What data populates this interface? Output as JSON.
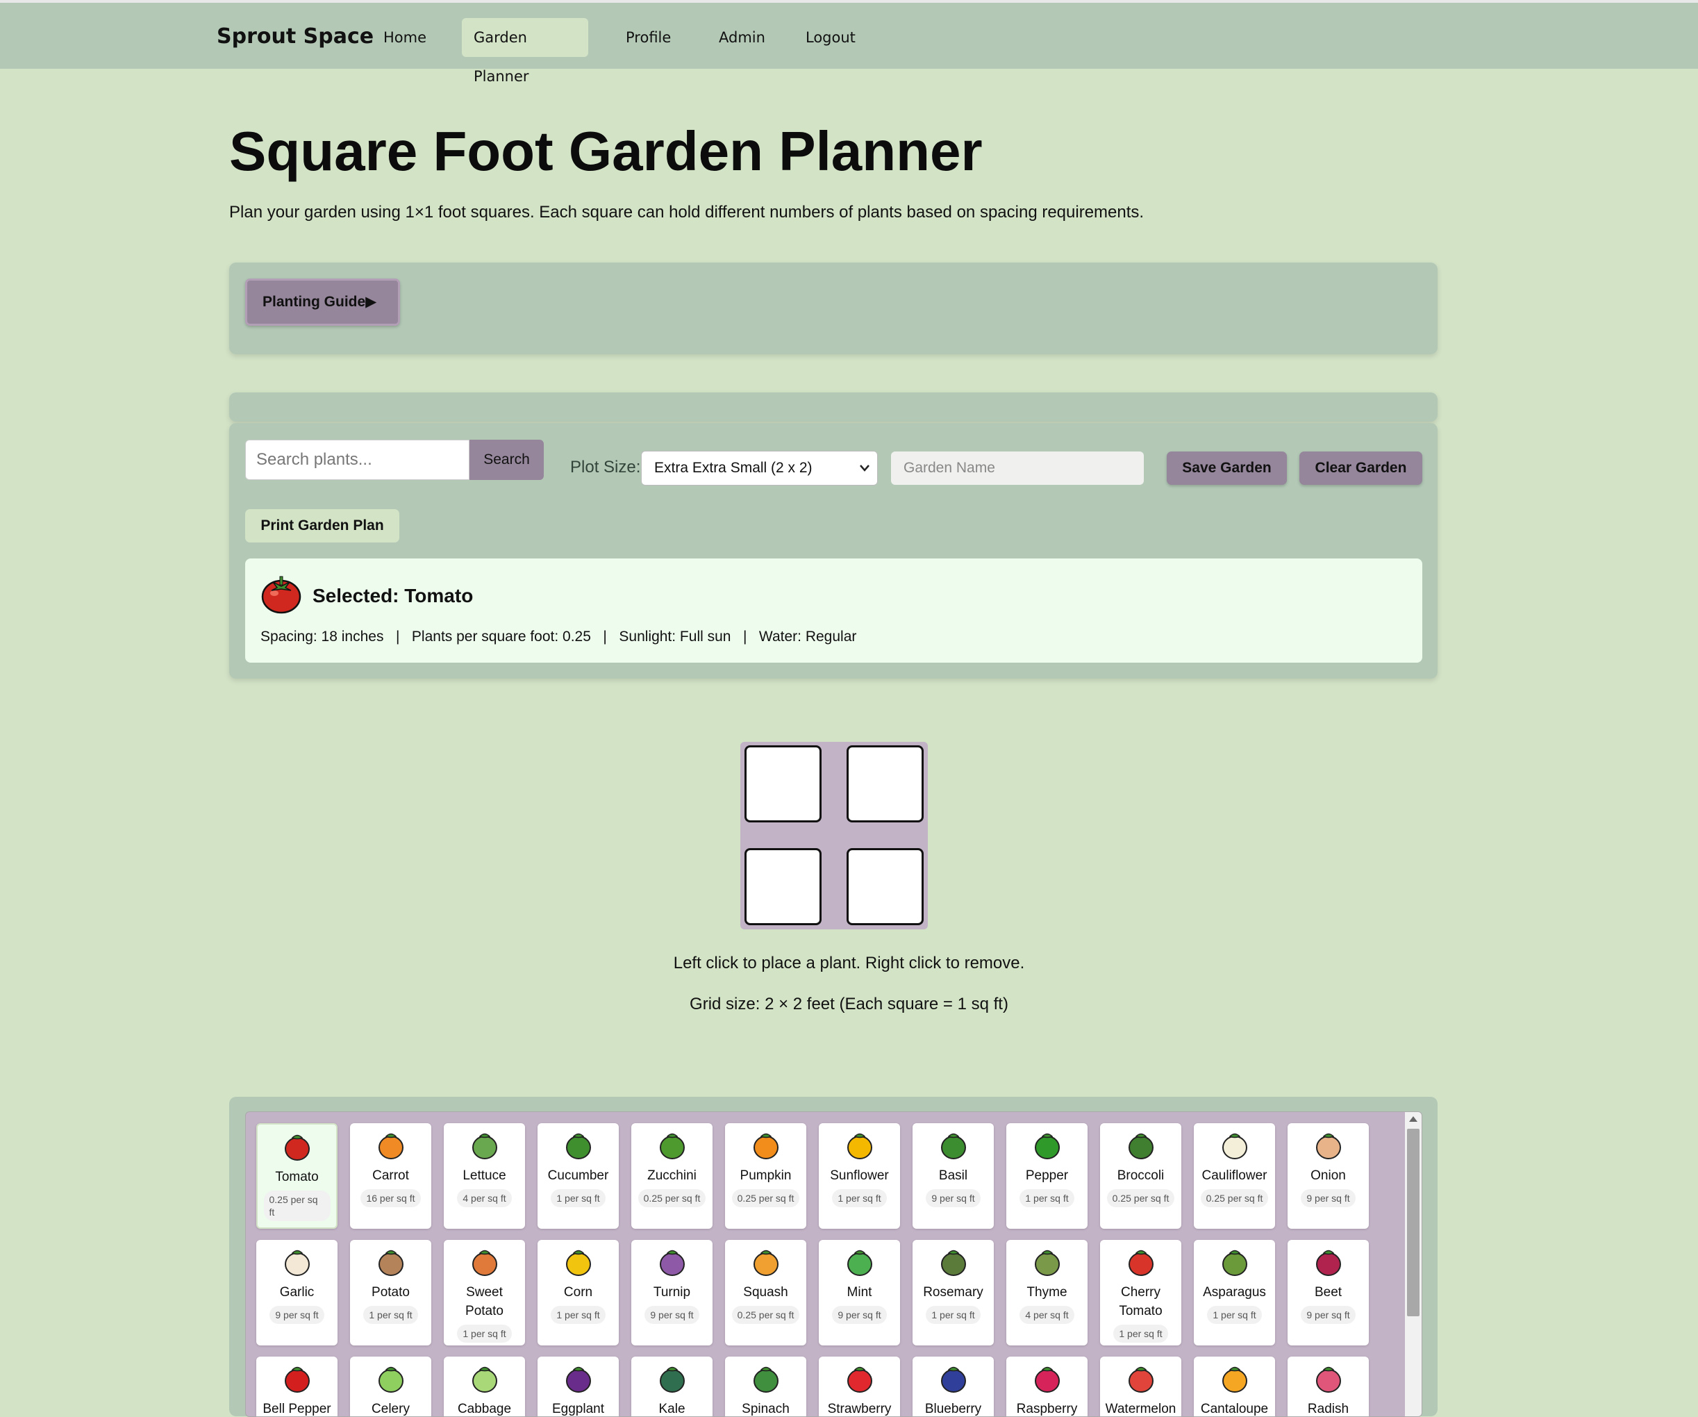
{
  "nav": {
    "brand": "Sprout Space",
    "items": [
      {
        "label": "Home",
        "active": false
      },
      {
        "label": "Garden Planner",
        "active": true
      },
      {
        "label": "Profile",
        "active": false
      },
      {
        "label": "Admin",
        "active": false
      },
      {
        "label": "Logout",
        "active": false
      }
    ]
  },
  "page": {
    "title": "Square Foot Garden Planner",
    "description": "Plan your garden using 1×1 foot squares. Each square can hold different numbers of plants based on spacing requirements."
  },
  "guide": {
    "label": "Planting Guide",
    "arrow": "▶"
  },
  "controls": {
    "search_placeholder": "Search plants...",
    "search_button": "Search",
    "plot_label": "Plot Size:",
    "plot_value": "Extra Extra Small (2 x 2)",
    "garden_name_placeholder": "Garden Name",
    "save_button": "Save Garden",
    "clear_button": "Clear Garden",
    "print_button": "Print Garden Plan"
  },
  "selected": {
    "title": "Selected: Tomato",
    "icon": "tomato-icon",
    "info": "Spacing: 18 inches   |   Plants per square foot: 0.25   |   Sunlight: Full sun   |   Water: Regular"
  },
  "grid": {
    "rows": 2,
    "cols": 2,
    "hint": "Left click to place a plant. Right click to remove.",
    "size_text": "Grid size: 2 × 2 feet (Each square = 1 sq ft)"
  },
  "plants": [
    {
      "name": "Tomato",
      "rate": "0.25 per sq ft",
      "color": "#d0281e",
      "selected": true
    },
    {
      "name": "Carrot",
      "rate": "16 per sq ft",
      "color": "#f08a24"
    },
    {
      "name": "Lettuce",
      "rate": "4 per sq ft",
      "color": "#6aa84f"
    },
    {
      "name": "Cucumber",
      "rate": "1 per sq ft",
      "color": "#3f8f2f"
    },
    {
      "name": "Zucchini",
      "rate": "0.25 per sq ft",
      "color": "#4f9a2f"
    },
    {
      "name": "Pumpkin",
      "rate": "0.25 per sq ft",
      "color": "#f28c1a"
    },
    {
      "name": "Sunflower",
      "rate": "1 per sq ft",
      "color": "#f5b800"
    },
    {
      "name": "Basil",
      "rate": "9 per sq ft",
      "color": "#3c8d2f"
    },
    {
      "name": "Pepper",
      "rate": "1 per sq ft",
      "color": "#2f9a2a"
    },
    {
      "name": "Broccoli",
      "rate": "0.25 per sq ft",
      "color": "#3f7f2f"
    },
    {
      "name": "Cauliflower",
      "rate": "0.25 per sq ft",
      "color": "#f3efd9"
    },
    {
      "name": "Onion",
      "rate": "9 per sq ft",
      "color": "#e9b38a"
    },
    {
      "name": "Garlic",
      "rate": "9 per sq ft",
      "color": "#f2e8d5"
    },
    {
      "name": "Potato",
      "rate": "1 per sq ft",
      "color": "#b5835a"
    },
    {
      "name": "Sweet Potato",
      "rate": "1 per sq ft",
      "color": "#e07a3a"
    },
    {
      "name": "Corn",
      "rate": "1 per sq ft",
      "color": "#f1c40f"
    },
    {
      "name": "Turnip",
      "rate": "9 per sq ft",
      "color": "#8e5aa8"
    },
    {
      "name": "Squash",
      "rate": "0.25 per sq ft",
      "color": "#f0a030"
    },
    {
      "name": "Mint",
      "rate": "9 per sq ft",
      "color": "#4caf50"
    },
    {
      "name": "Rosemary",
      "rate": "1 per sq ft",
      "color": "#5b7b3a"
    },
    {
      "name": "Thyme",
      "rate": "4 per sq ft",
      "color": "#7a9a4a"
    },
    {
      "name": "Cherry Tomato",
      "rate": "1 per sq ft",
      "color": "#d9342a"
    },
    {
      "name": "Asparagus",
      "rate": "1 per sq ft",
      "color": "#6b9a3a"
    },
    {
      "name": "Beet",
      "rate": "9 per sq ft",
      "color": "#b0234f"
    },
    {
      "name": "Bell Pepper",
      "rate": "",
      "color": "#d41f1f"
    },
    {
      "name": "Celery",
      "rate": "",
      "color": "#8fcf5f"
    },
    {
      "name": "Cabbage",
      "rate": "",
      "color": "#a8d878"
    },
    {
      "name": "Eggplant",
      "rate": "",
      "color": "#6a2c8a"
    },
    {
      "name": "Kale",
      "rate": "",
      "color": "#2f6f4f"
    },
    {
      "name": "Spinach",
      "rate": "",
      "color": "#3f8f3f"
    },
    {
      "name": "Strawberry",
      "rate": "",
      "color": "#e0282e"
    },
    {
      "name": "Blueberry",
      "rate": "",
      "color": "#2f3f9a"
    },
    {
      "name": "Raspberry",
      "rate": "",
      "color": "#d6245a"
    },
    {
      "name": "Watermelon",
      "rate": "",
      "color": "#e0443a"
    },
    {
      "name": "Cantaloupe",
      "rate": "",
      "color": "#f5a623"
    },
    {
      "name": "Radish",
      "rate": "",
      "color": "#e0557a"
    }
  ]
}
